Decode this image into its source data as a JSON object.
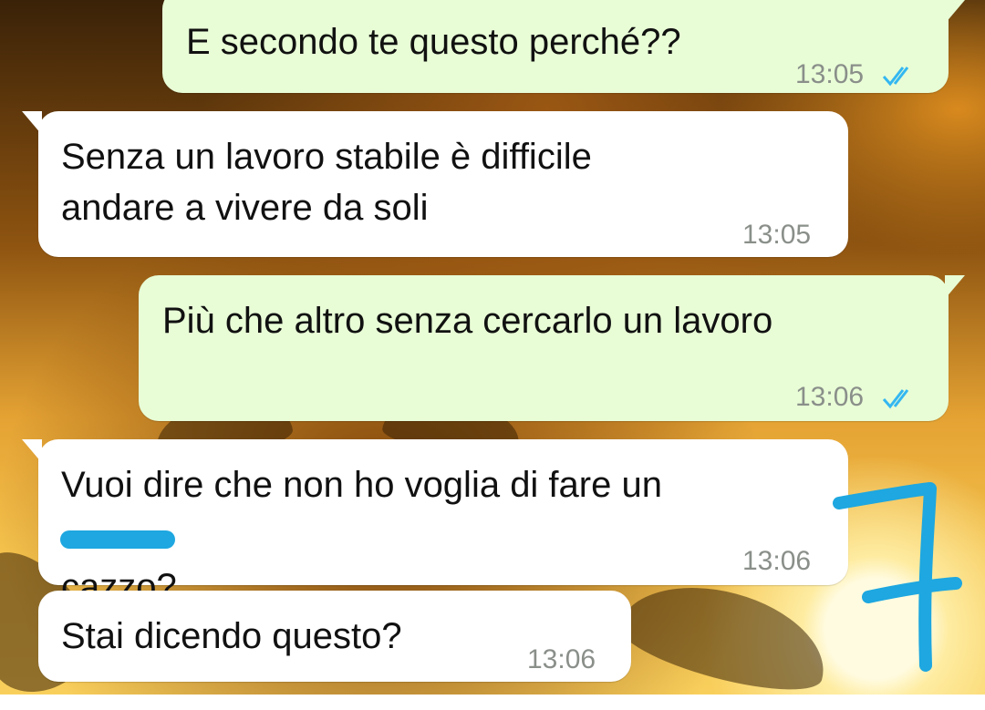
{
  "chat": {
    "messages": [
      {
        "direction": "outgoing",
        "text": "E secondo te questo perché??",
        "time": "13:05",
        "status": "read-double-tick"
      },
      {
        "direction": "incoming",
        "text": "Senza un lavoro stabile è difficile\nandare a vivere da soli",
        "time": "13:05"
      },
      {
        "direction": "outgoing",
        "text": "Più che altro senza cercarlo un lavoro",
        "time": "13:06",
        "status": "read-double-tick"
      },
      {
        "direction": "incoming",
        "text_line1": "Vuoi dire che non ho voglia di fare un",
        "text_line2_redacted": "cazzo",
        "text_line2_suffix": "?",
        "time": "13:06"
      },
      {
        "direction": "incoming",
        "text": "Stai dicendo questo?",
        "time": "13:06"
      }
    ]
  },
  "annotation": {
    "handwritten_number": "7",
    "color": "#1ea7e0"
  },
  "colors": {
    "outgoing_bubble": "#e8fdd6",
    "incoming_bubble": "#ffffff",
    "read_tick": "#34b7f1",
    "timestamp": "#8a8f8a"
  },
  "icons": [
    "double-check-icon"
  ]
}
